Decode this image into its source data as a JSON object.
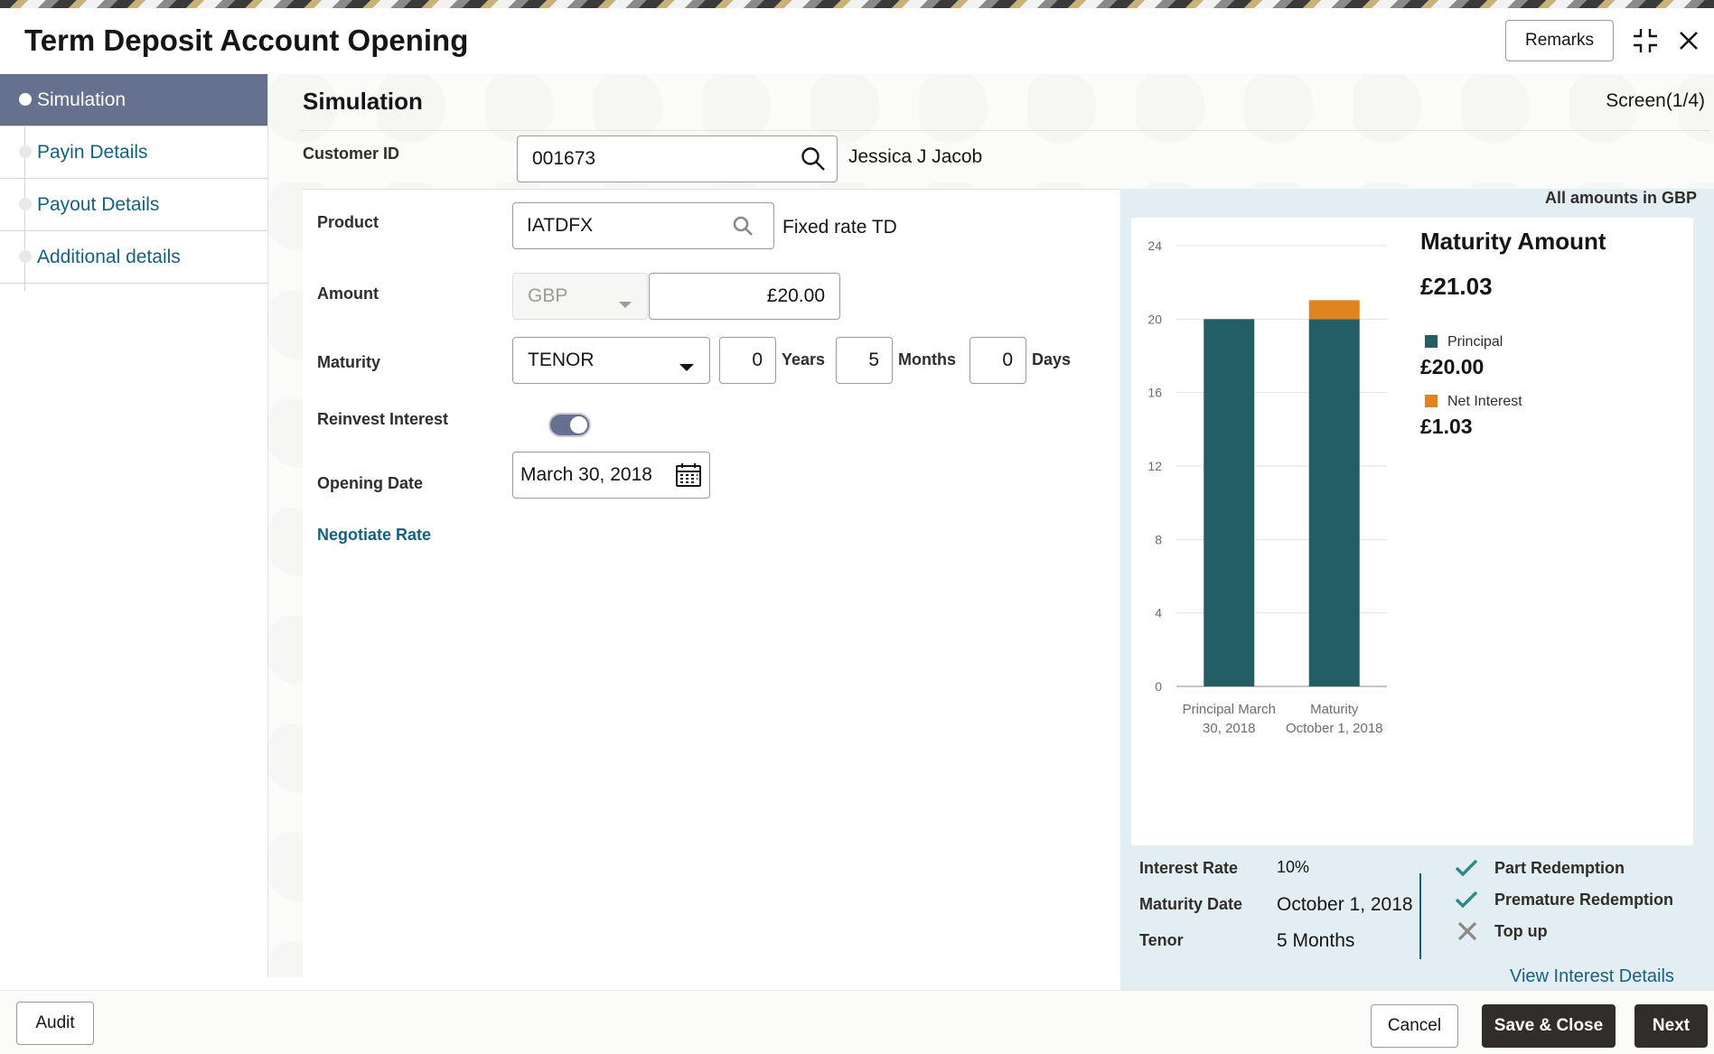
{
  "header": {
    "title": "Term Deposit Account Opening",
    "remarks_label": "Remarks",
    "icons": [
      "collapse-icon",
      "close-icon"
    ]
  },
  "sidebar": {
    "items": [
      {
        "label": "Simulation",
        "active": true
      },
      {
        "label": "Payin Details",
        "active": false
      },
      {
        "label": "Payout Details",
        "active": false
      },
      {
        "label": "Additional details",
        "active": false
      }
    ]
  },
  "main": {
    "section_title": "Simulation",
    "screen_count": "Screen(1/4)",
    "customer": {
      "label": "Customer ID",
      "value": "001673",
      "name": "Jessica J Jacob"
    },
    "product": {
      "label": "Product",
      "value": "IATDFX",
      "description": "Fixed rate TD"
    },
    "amount": {
      "label": "Amount",
      "currency": "GBP",
      "value": "£20.00"
    },
    "maturity": {
      "label": "Maturity",
      "type": "TENOR",
      "years": "0",
      "years_label": "Years",
      "months": "5",
      "months_label": "Months",
      "days": "0",
      "days_label": "Days"
    },
    "reinvest": {
      "label": "Reinvest Interest",
      "on": true
    },
    "opening_date": {
      "label": "Opening Date",
      "value": "March 30, 2018"
    },
    "negotiate_label": "Negotiate Rate"
  },
  "summary": {
    "currency_note": "All amounts in GBP",
    "maturity_title": "Maturity Amount",
    "maturity_amount": "£21.03",
    "legend": [
      {
        "label": "Principal",
        "value": "£20.00",
        "color": "#235e67"
      },
      {
        "label": "Net Interest",
        "value": "£1.03",
        "color": "#e0841f"
      }
    ],
    "stats": [
      {
        "label": "Interest Rate",
        "value": "10%"
      },
      {
        "label": "Maturity Date",
        "value": "October 1, 2018"
      },
      {
        "label": "Tenor",
        "value": "5 Months"
      }
    ],
    "features": [
      {
        "label": "Part Redemption",
        "enabled": true
      },
      {
        "label": "Premature Redemption",
        "enabled": true
      },
      {
        "label": "Top up",
        "enabled": false
      }
    ],
    "view_details": "View Interest Details"
  },
  "chart_data": {
    "type": "bar",
    "categories": [
      [
        "Principal March",
        "30, 2018"
      ],
      [
        "Maturity",
        "October 1, 2018"
      ]
    ],
    "series": [
      {
        "name": "Principal",
        "values": [
          20,
          20
        ],
        "color": "#235e67"
      },
      {
        "name": "Net Interest",
        "values": [
          0,
          1.03
        ],
        "color": "#e0841f"
      }
    ],
    "stacked": true,
    "ylim": [
      0,
      24
    ],
    "yticks": [
      0,
      4,
      8,
      12,
      16,
      20,
      24
    ],
    "grid": true
  },
  "footer": {
    "audit": "Audit",
    "cancel": "Cancel",
    "save_close": "Save & Close",
    "next": "Next"
  }
}
